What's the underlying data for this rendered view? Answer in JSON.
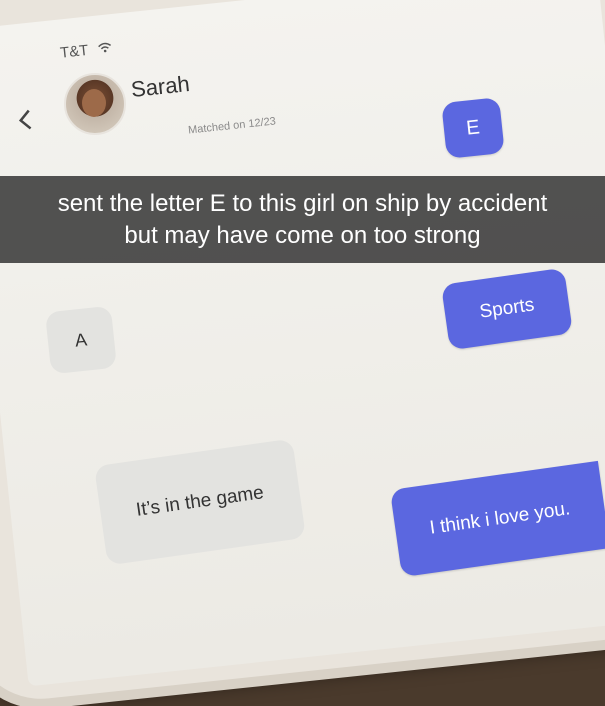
{
  "status": {
    "carrier": "T&T"
  },
  "header": {
    "name": "Sarah",
    "matched": "Matched on 12/23"
  },
  "messages": {
    "e": "E",
    "a": "A",
    "sports": "Sports",
    "game": "It’s in the game",
    "love": "I think i love you."
  },
  "caption": {
    "line1": "sent the letter E to this girl on ship by accident",
    "line2": "but may have come on too strong"
  },
  "colors": {
    "sent_bubble": "#5b67e0",
    "received_bubble": "#e3e3e0"
  }
}
